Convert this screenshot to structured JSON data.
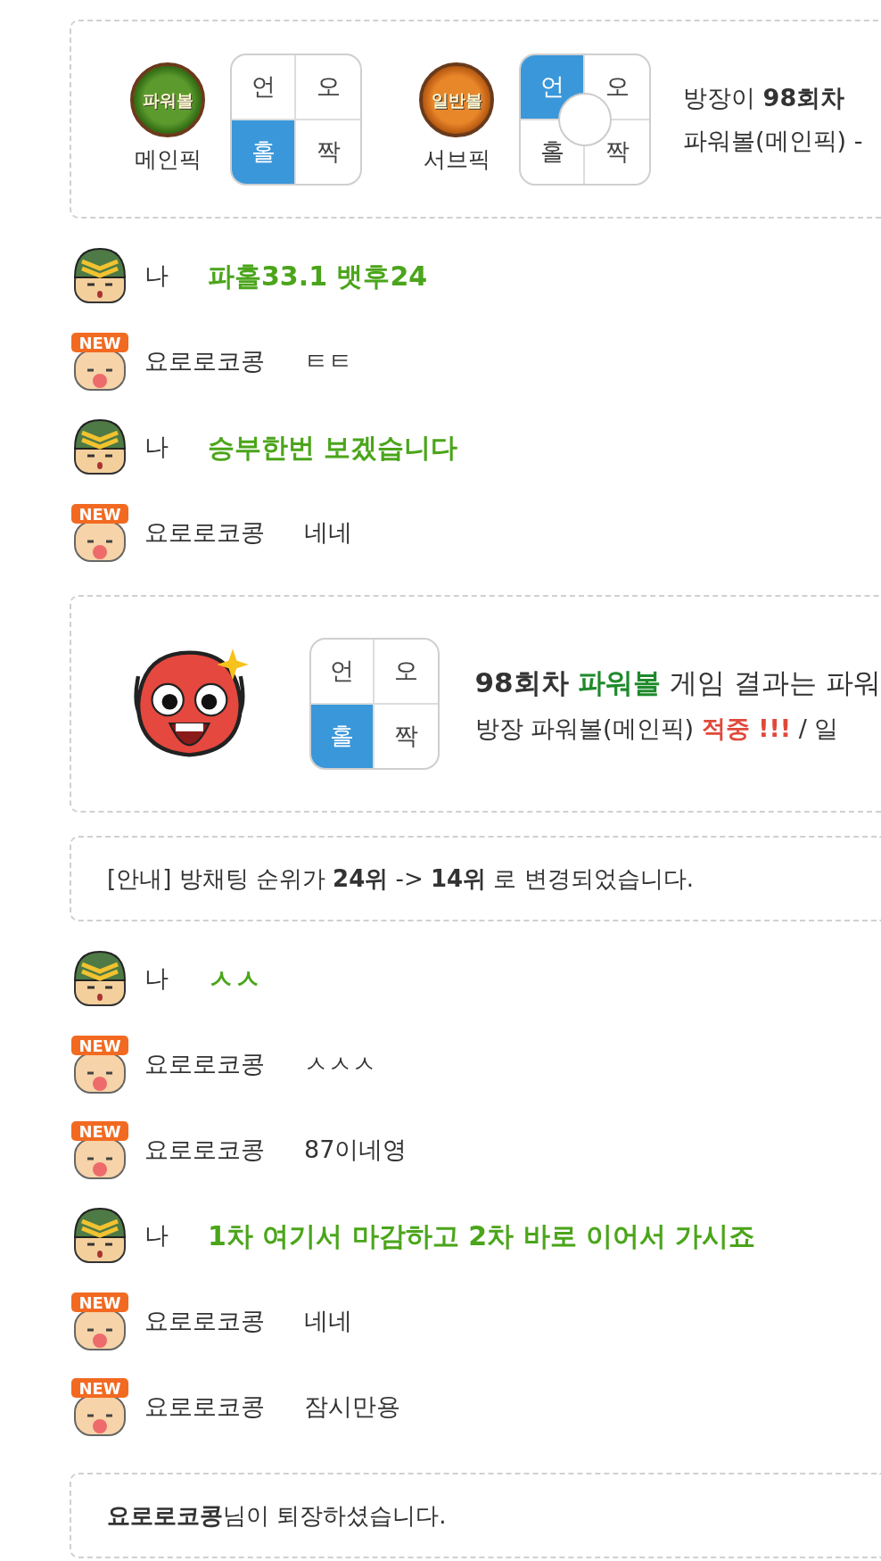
{
  "feed": [
    {
      "kind": "pick",
      "picks": [
        {
          "ball": {
            "kind": "power",
            "text": "파워볼"
          },
          "label": "메인픽",
          "grid": {
            "center_circle": false,
            "cells": [
              {
                "text": "언",
                "selected": false
              },
              {
                "text": "오",
                "selected": false
              },
              {
                "text": "홀",
                "selected": true
              },
              {
                "text": "짝",
                "selected": false
              }
            ]
          }
        },
        {
          "ball": {
            "kind": "normal",
            "text": "일반볼"
          },
          "label": "서브픽",
          "grid": {
            "center_circle": true,
            "cells": [
              {
                "text": "언",
                "selected": true
              },
              {
                "text": "오",
                "selected": false
              },
              {
                "text": "홀",
                "selected": false
              },
              {
                "text": "짝",
                "selected": false
              }
            ]
          }
        }
      ],
      "lines": [
        [
          {
            "text": "방장이 ",
            "kind": "plain"
          },
          {
            "text": "98회차",
            "kind": "strong"
          }
        ],
        [
          {
            "text": "파워볼(메인픽) -",
            "kind": "plain"
          }
        ]
      ]
    },
    {
      "kind": "chat",
      "avatar": {
        "kind": "soldier"
      },
      "user": "나",
      "text": "파홀33.1 뱃후24",
      "highlight": true
    },
    {
      "kind": "chat",
      "avatar": {
        "kind": "rookie",
        "badge": "NEW"
      },
      "user": "요로로코콩",
      "text": "ㅌㅌ",
      "highlight": false
    },
    {
      "kind": "chat",
      "avatar": {
        "kind": "soldier"
      },
      "user": "나",
      "text": "승부한번 보겠습니다",
      "highlight": true
    },
    {
      "kind": "chat",
      "avatar": {
        "kind": "rookie",
        "badge": "NEW"
      },
      "user": "요로로코콩",
      "text": "네네",
      "highlight": false
    },
    {
      "kind": "result",
      "grid": {
        "center_circle": false,
        "cells": [
          {
            "text": "언",
            "selected": false
          },
          {
            "text": "오",
            "selected": false
          },
          {
            "text": "홀",
            "selected": true
          },
          {
            "text": "짝",
            "selected": false
          }
        ]
      },
      "lines": [
        [
          {
            "text": "98회차 ",
            "kind": "strong"
          },
          {
            "text": "파워볼",
            "kind": "game"
          },
          {
            "text": " 게임 결과는 파워",
            "kind": "plain"
          }
        ],
        [
          {
            "text": "방장 파워볼(메인픽) ",
            "kind": "plain"
          },
          {
            "text": "적중 !!!",
            "kind": "hit"
          },
          {
            "text": " / 일",
            "kind": "plain"
          }
        ]
      ]
    },
    {
      "kind": "notice",
      "text": "[안내] 방채팅 순위가 **24위** -> **14위** 로 변경되었습니다."
    },
    {
      "kind": "chat",
      "avatar": {
        "kind": "soldier"
      },
      "user": "나",
      "text": "ㅅㅅ",
      "highlight": true
    },
    {
      "kind": "chat",
      "avatar": {
        "kind": "rookie",
        "badge": "NEW"
      },
      "user": "요로로코콩",
      "text": "ㅅㅅㅅ",
      "highlight": false
    },
    {
      "kind": "chat",
      "avatar": {
        "kind": "rookie",
        "badge": "NEW"
      },
      "user": "요로로코콩",
      "text": "87이네영",
      "highlight": false
    },
    {
      "kind": "chat",
      "avatar": {
        "kind": "soldier"
      },
      "user": "나",
      "text": "1차 여기서 마감하고 2차 바로 이어서 가시죠",
      "highlight": true
    },
    {
      "kind": "chat",
      "avatar": {
        "kind": "rookie",
        "badge": "NEW"
      },
      "user": "요로로코콩",
      "text": "네네",
      "highlight": false
    },
    {
      "kind": "chat",
      "avatar": {
        "kind": "rookie",
        "badge": "NEW"
      },
      "user": "요로로코콩",
      "text": "잠시만용",
      "highlight": false
    },
    {
      "kind": "notice",
      "text": "**요로로코콩**님이 퇴장하셨습니다."
    }
  ]
}
